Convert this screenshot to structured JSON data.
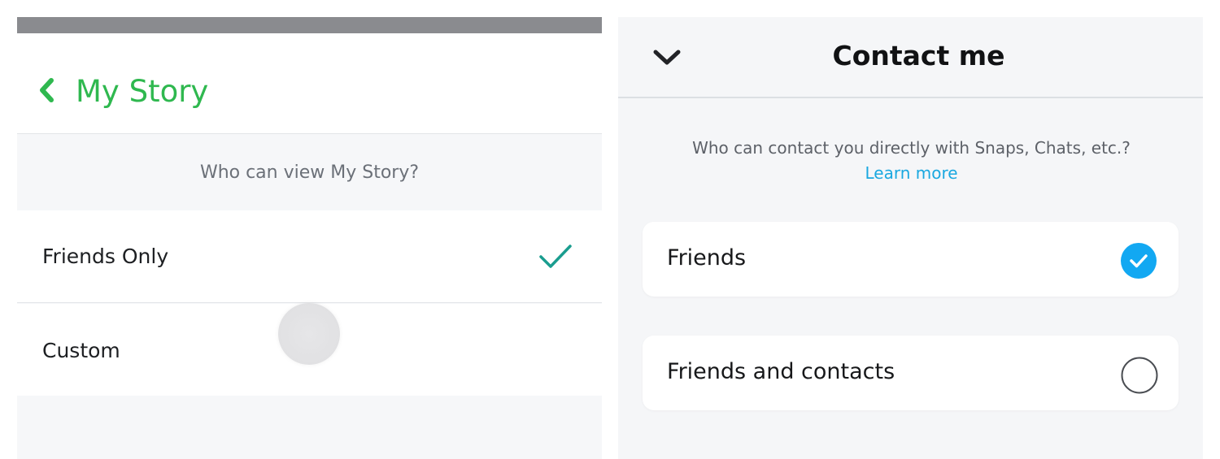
{
  "left_panel": {
    "title": "My Story",
    "back_icon": "chevron-left-icon",
    "question": "Who can view My Story?",
    "options": [
      {
        "label": "Friends Only",
        "selected": true
      },
      {
        "label": "Custom",
        "selected": false
      }
    ],
    "colors": {
      "accent_title": "#2fb84f",
      "check": "#1a9d8f"
    }
  },
  "right_panel": {
    "title": "Contact me",
    "collapse_icon": "chevron-down-icon",
    "question": "Who can contact you directly with Snaps, Chats, etc.?",
    "learn_more": "Learn more",
    "options": [
      {
        "label": "Friends",
        "selected": true
      },
      {
        "label": "Friends and contacts",
        "selected": false
      }
    ],
    "colors": {
      "link": "#1aa8e0",
      "radio_selected": "#12a8f2"
    }
  }
}
